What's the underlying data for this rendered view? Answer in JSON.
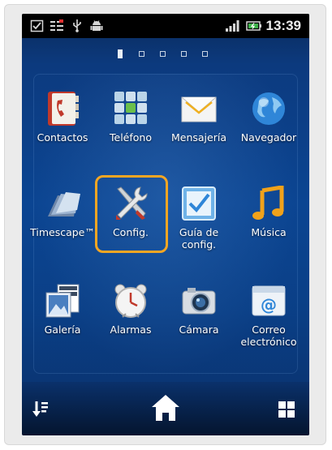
{
  "status_bar": {
    "time": "13:39",
    "icons": [
      "checkbox-notification-icon",
      "tasks-icon",
      "usb-icon",
      "android-debug-icon",
      "signal-bars-icon",
      "battery-icon"
    ]
  },
  "home_pages": {
    "count": 5,
    "active_index": 0
  },
  "apps": [
    {
      "label": "Contactos",
      "icon": "phonebook-icon"
    },
    {
      "label": "Teléfono",
      "icon": "keypad-icon"
    },
    {
      "label": "Mensajería",
      "icon": "envelope-icon"
    },
    {
      "label": "Navegador",
      "icon": "globe-icon"
    },
    {
      "label": "Timescape™",
      "icon": "timescape-icon"
    },
    {
      "label": "Config.",
      "icon": "wrench-screwdriver-icon"
    },
    {
      "label": "Guía de\nconfig.",
      "icon": "checkbox-setup-icon"
    },
    {
      "label": "Música",
      "icon": "music-note-icon"
    },
    {
      "label": "Galería",
      "icon": "gallery-icon"
    },
    {
      "label": "Alarmas",
      "icon": "alarm-clock-icon"
    },
    {
      "label": "Cámara",
      "icon": "camera-icon"
    },
    {
      "label": "Correo\nelectrónico",
      "icon": "email-icon"
    }
  ],
  "highlighted_app": "Config.",
  "dock": {
    "left": "sort-apps-icon",
    "center": "home-icon",
    "right": "app-grid-icon"
  },
  "colors": {
    "highlight": "#f5a623",
    "wallpaper": "#0b4592"
  }
}
